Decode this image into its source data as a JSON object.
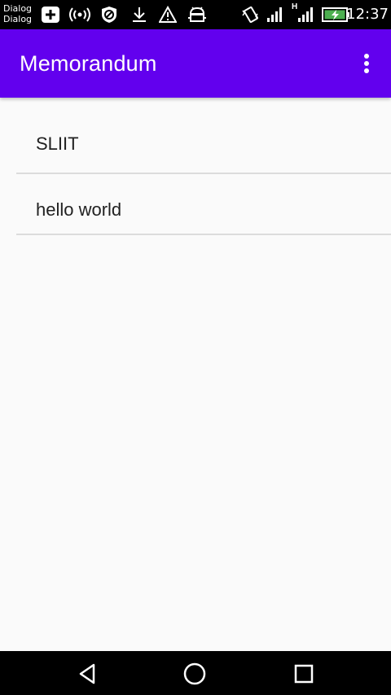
{
  "status_bar": {
    "carrier_line1": "Dialog",
    "carrier_line2": "Dialog",
    "time": "12:37",
    "network_label": "H",
    "icons": [
      "add-box-icon",
      "wireless-broadcast-icon",
      "blocked-icon",
      "download-icon",
      "warning-icon",
      "android-debug-icon",
      "vibrate-icon",
      "signal-icon",
      "signal-h-icon",
      "battery-charging-icon"
    ],
    "battery_color": "#4caf50"
  },
  "app_bar": {
    "title": "Memorandum",
    "background": "#6200ee",
    "overflow_icon": "more-vert-icon"
  },
  "notes": [
    {
      "label": "SLIIT"
    },
    {
      "label": "hello world"
    }
  ],
  "nav_bar": {
    "icons": [
      "back-icon",
      "home-icon",
      "recents-icon"
    ]
  }
}
